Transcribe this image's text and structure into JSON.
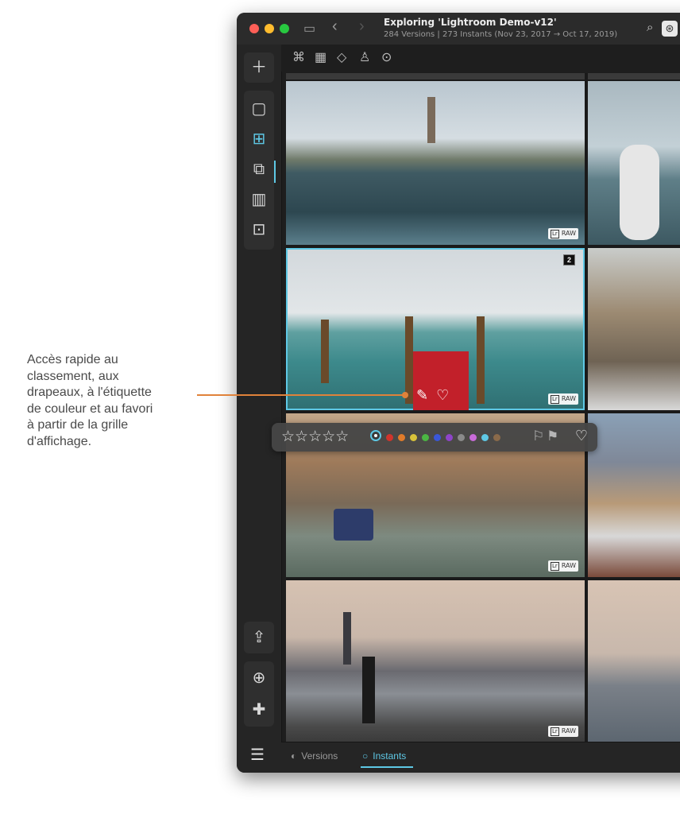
{
  "annotation": {
    "line1": "Accès rapide au",
    "line2": "classement, aux",
    "line3": "drapeaux, à l'étiquette",
    "line4": "de couleur et au favori",
    "line5": "à partir de la grille",
    "line6": "d'affichage."
  },
  "window": {
    "title": "Exploring 'Lightroom Demo-v12'",
    "subtitle": "284 Versions | 273 Instants (Nov 23, 2017 → Oct 17, 2019)"
  },
  "photos": {
    "badge_lr": "Lr",
    "badge_raw": "RAW",
    "stack_count": "2"
  },
  "rating": {
    "stars": "☆☆☆☆☆",
    "colors": [
      "#d0342c",
      "#e07b2a",
      "#d8c23a",
      "#4bb543",
      "#3a57d8",
      "#8e44c9",
      "#8a8a8a",
      "#c86bd8",
      "#5ec8e5",
      "#8a6a4a"
    ]
  },
  "bottom": {
    "versions_label": "Versions",
    "instants_label": "Instants"
  }
}
